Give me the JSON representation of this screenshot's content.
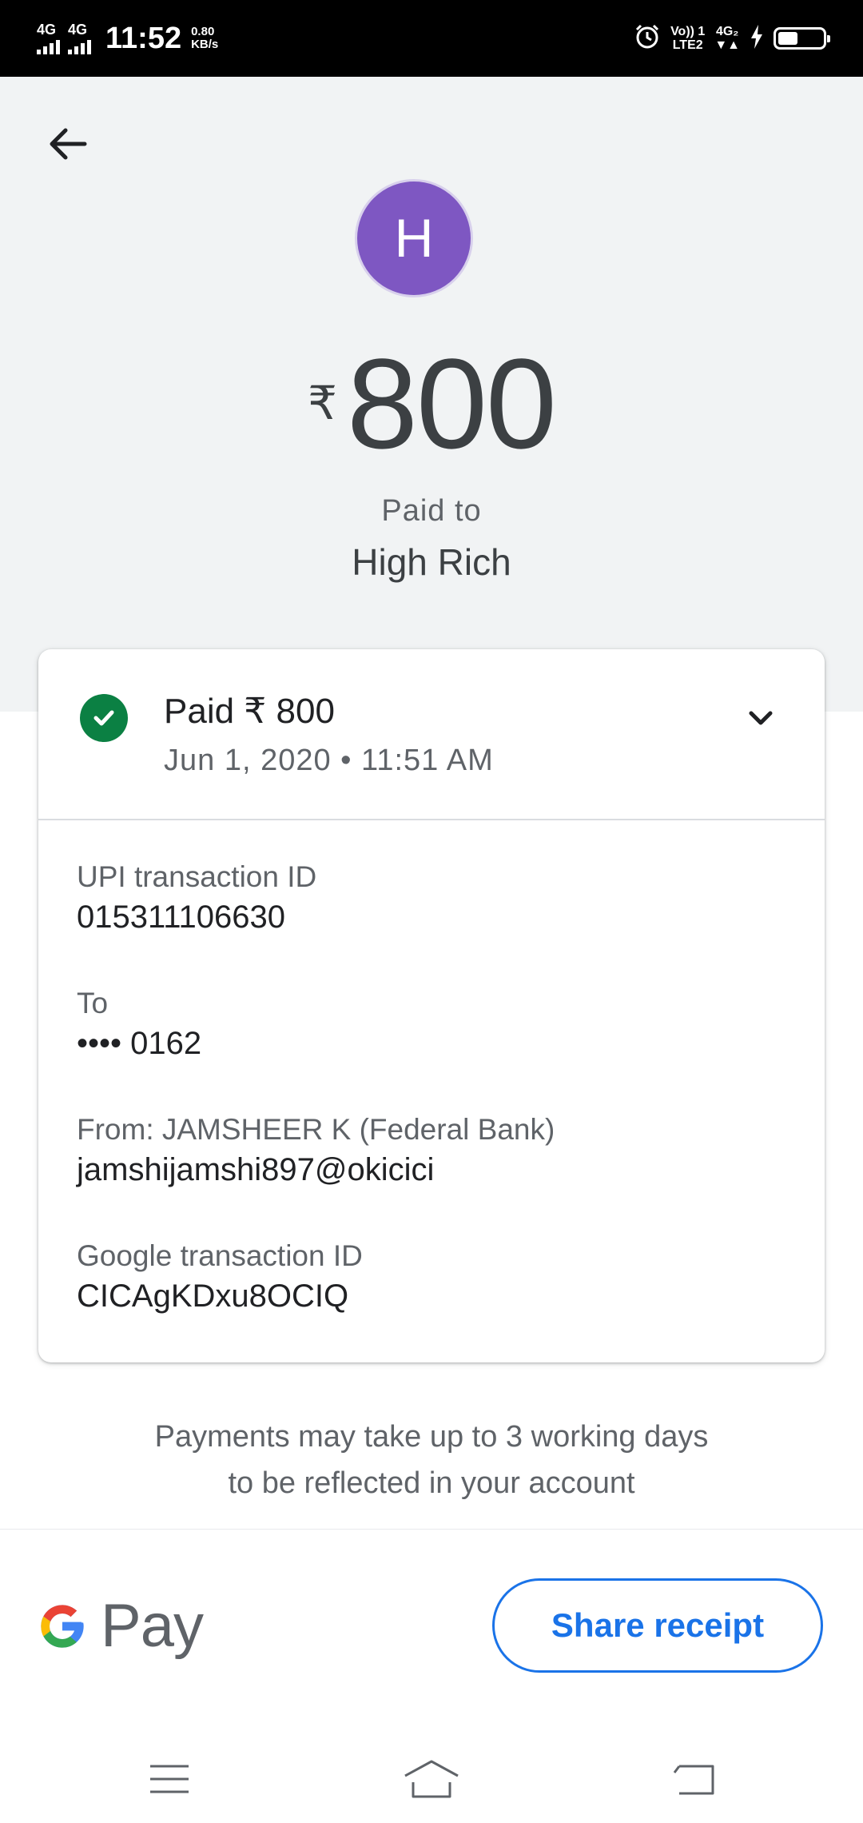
{
  "status_bar": {
    "net1": "4G",
    "net2": "4G",
    "time": "11:52",
    "speed_value": "0.80",
    "speed_unit": "KB/s",
    "volte_top": "Vo)) 1",
    "volte_bottom": "LTE2",
    "net3": "4G₂",
    "battery_level": 0.45
  },
  "header": {
    "avatar_letter": "H",
    "avatar_color": "#7e57c2",
    "currency_symbol": "₹",
    "amount": "800",
    "paid_to_label": "Paid to",
    "payee_name": "High Rich"
  },
  "card": {
    "status_text": "Paid ₹ 800",
    "date_time": "Jun 1, 2020 • 11:51 AM",
    "status_color": "#0b8043",
    "details": [
      {
        "label": "UPI transaction ID",
        "value": "015311106630"
      },
      {
        "label": "To",
        "value": "•••• 0162"
      },
      {
        "label": "From: JAMSHEER K (Federal Bank)",
        "value": "jamshijamshi897@okicici"
      },
      {
        "label": "Google transaction ID",
        "value": "CICAgKDxu8OCIQ"
      }
    ]
  },
  "note": {
    "line1": "Payments may take up to 3 working days",
    "line2": "to be reflected in your account"
  },
  "footer": {
    "brand_text": "Pay",
    "share_label": "Share receipt",
    "accent": "#1a73e8"
  },
  "icons": [
    "back-arrow-icon",
    "check-circle-icon",
    "chevron-down-icon",
    "google-g-icon",
    "menu-icon",
    "home-icon",
    "back-nav-icon"
  ]
}
